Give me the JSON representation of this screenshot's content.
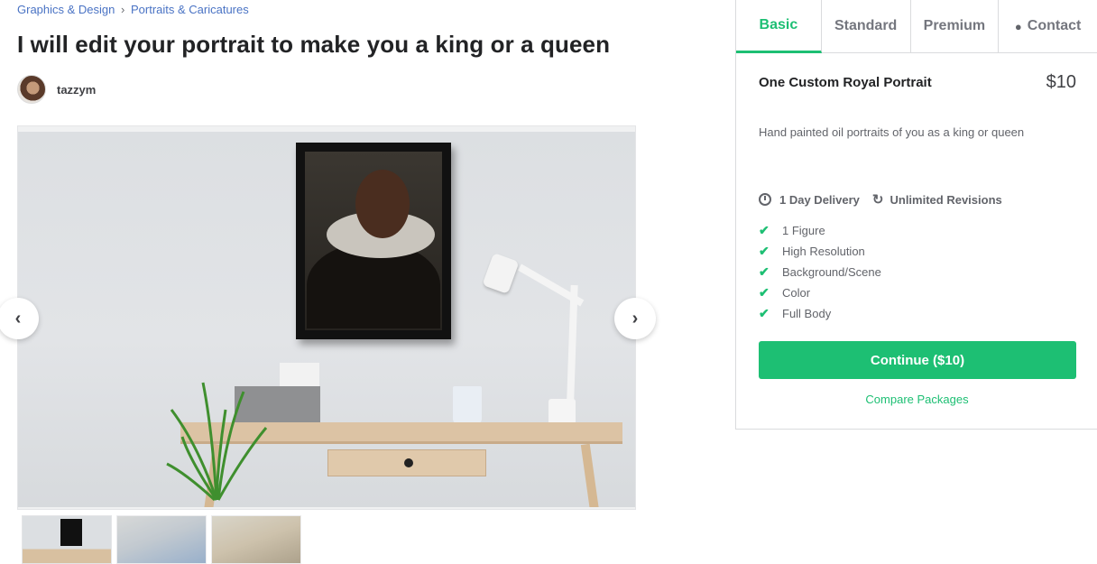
{
  "breadcrumb": {
    "items": [
      "Graphics & Design",
      "Portraits & Caricatures"
    ],
    "separator": "›"
  },
  "gig": {
    "title": "I will edit your portrait to make you a king or a queen",
    "seller_name": "tazzym"
  },
  "gallery": {
    "prev_icon": "‹",
    "next_icon": "›",
    "thumbnail_count": 3
  },
  "package_tabs": [
    "Basic",
    "Standard",
    "Premium",
    "Contact"
  ],
  "package": {
    "name": "One Custom Royal Portrait",
    "price": "$10",
    "description": "Hand painted oil portraits of you as a king or queen",
    "delivery": "1 Day Delivery",
    "revisions": "Unlimited Revisions",
    "features": [
      "1 Figure",
      "High Resolution",
      "Background/Scene",
      "Color",
      "Full Body"
    ],
    "continue_label": "Continue ($10)",
    "compare_label": "Compare Packages"
  },
  "colors": {
    "accent": "#1dbf73",
    "link": "#4a73c4",
    "text": "#222325"
  },
  "icons": {
    "delivery": "clock-icon",
    "revisions": "refresh-icon",
    "feature": "check-icon",
    "contact": "chat-bubble-icon"
  }
}
